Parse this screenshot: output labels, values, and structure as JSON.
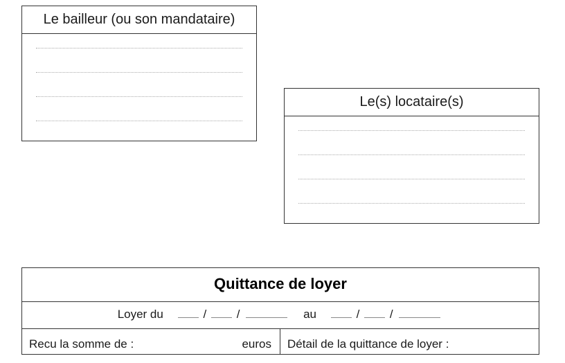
{
  "bailleur": {
    "header": "Le bailleur (ou son mandataire)"
  },
  "locataire": {
    "header": "Le(s) locataire(s)"
  },
  "main": {
    "title": "Quittance de loyer",
    "date_prefix": "Loyer du",
    "date_mid": "au",
    "slash": "/",
    "left_label": "Recu la somme de :",
    "left_unit": "euros",
    "right_label": "Détail de la quittance de loyer :"
  }
}
